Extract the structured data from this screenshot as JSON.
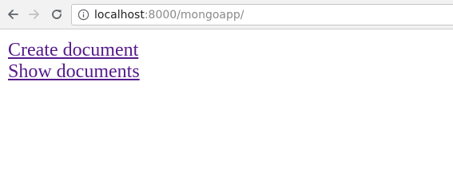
{
  "browser": {
    "back_icon": "arrow-left-icon",
    "forward_icon": "arrow-right-icon",
    "reload_icon": "reload-icon",
    "info_icon": "info-icon",
    "url_host": "localhost",
    "url_rest": ":8000/mongoapp/"
  },
  "page": {
    "links": [
      {
        "label": "Create document"
      },
      {
        "label": "Show documents"
      }
    ],
    "link_color": "#551a8b"
  }
}
